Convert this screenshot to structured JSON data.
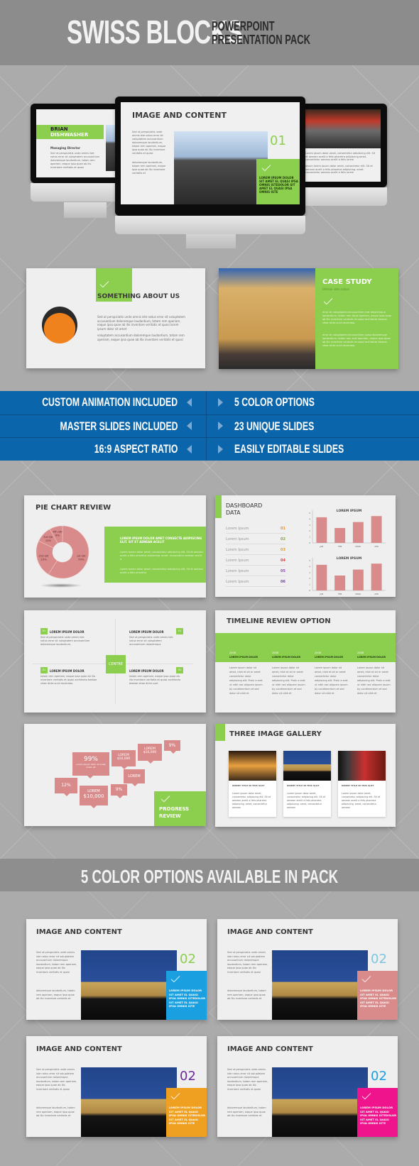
{
  "header": {
    "title": "SWISS BLOCKS",
    "subtitle_line1": "POWERPOINT",
    "subtitle_line2": "PRESENTATION PACK"
  },
  "monitors": {
    "left": {
      "name_line1": "BRIAN",
      "name_line2": "DISHWASHER",
      "role": "Managing Director",
      "body": "Sed ut perspiciatis unde omnis iste natus error sit voluptatem accusantium doloremque laudantium, totam rem aperiam, eaque ipsa quae ab illo inventore veritatis et quasi"
    },
    "center": {
      "title": "IMAGE AND CONTENT",
      "number": "01",
      "body1": "Sed ut perspiciatis unde omnis iste natus error sit voluptatem accusantium doloremque laudantium, totam rem aperiam, eaque ipsa quae ab illo inventore veritatis et quasi",
      "body2": "doloremque laudantium, totam rem aperiam, eaque ipsa quae ab illo inventore veritatis et",
      "box_text": "LOREM IPSUM DOLOR SIT AMET EL QUASI IPSA OMNIS ISTEDOLOR SIT AMET EL QUASI IPSA OMNIS ISTE"
    },
    "right": {
      "body1": "Lorem ipsum dolor amet, consectetur adipiscing elit. Sit et aenean acelit a felis pharetra adipiscing amet, consectetur aenean acelit a felis lorem",
      "body2": "Ipsum lorem ipsum dolor amet, consectetur elit. Sit et aenean acelit a felis pharetra adipiscing. amet, consectetur aenean acelit a felis lorem"
    }
  },
  "about_slide": {
    "title": "SOMETHING ABOUT US",
    "body1": "Sed ut perspiciatis unde omnis iste natus error sit voluptatem accusantium doloremque laudantium, totam rem aperiam, eaque ipsa quae ab illo inventore veritatis et quasi lorem ipsum dolor sit amet",
    "body2": "voluptatem accusantium doloremque laudantium, totam rem aperiam, eaque ipsa quae ab illo inventore veritatis et quasi"
  },
  "case_study": {
    "title": "CASE STUDY",
    "subtitle": "Omnis iste natus",
    "body1": "error sit voluptatem accusantium erat doloremque laudantium, totam rem dicta aperiam, eaque ipsa quae ab illo inventore veritatis et quasi architecto beatae vitae dicta sunt explicabo.",
    "body2": "error sit voluptatem accusantium quisa doloremque laudantium, totam rem erat aperiam, eaque ipsa quae ab illo inventore veritatis et quasi architecto beatae vitae dicta sunt explicabo."
  },
  "features": {
    "left": [
      "CUSTOM ANIMATION INCLUDED",
      "MASTER SLIDES INCLUDED",
      "16:9 ASPECT  RATIO"
    ],
    "right": [
      "5 COLOR OPTIONS",
      "23 UNIQUE SLIDES",
      "EASILY EDITABLE SLIDES"
    ],
    "band_color": "#0b65ab"
  },
  "pie_slide": {
    "title": "PIE CHART REVIEW",
    "box_heading": "LOREM IPSUM DOLOR AMET CONSECTE ADIPISCING ELIT. SIT ET AENEAN ACELIT",
    "box_body1": "Lorem ipsum dolor amet, consectetur adipiscing elit. Sit et aenean acelit a felis pharetra adipiscing. amet, consectetur aenean acelit a",
    "box_body2": "Lorem ipsum dolor amet, consectetur adipiscing elit. Sit et aenean acelit a felis pharetra"
  },
  "dashboard_slide": {
    "title_line1": "DASHBOARD",
    "title_line2": "DATA",
    "rows": [
      {
        "label": "Lorem Ipsum",
        "num": "01",
        "color": "#e8922e"
      },
      {
        "label": "Lorem Ipsum",
        "num": "02",
        "color": "#7aab3a"
      },
      {
        "label": "Lorem Ipsum",
        "num": "03",
        "color": "#e0a21f"
      },
      {
        "label": "Lorem Ipsum",
        "num": "04",
        "color": "#e23b3b"
      },
      {
        "label": "Lorem Ipsum",
        "num": "05",
        "color": "#9a43c9"
      },
      {
        "label": "Lorem Ipsum",
        "num": "06",
        "color": "#7a3fb8"
      }
    ]
  },
  "centre_slide": {
    "centre_label": "CENTRE",
    "badge": "01",
    "items": [
      {
        "heading": "LOREM IPSUM DOLOR",
        "body": "Sed ut perspiciatis unde omnis iste natus error sit voluptatem accusantium doloremque laudantium,"
      },
      {
        "heading": "LOREM IPSUM DOLOR",
        "body": "Sed ut perspiciatis unde omnis iste natus error sit voluptatem accusantium doloremque"
      },
      {
        "heading": "LOREM IPSUM DOLOR",
        "body": "totam rem aperiam, eaque ipsa quae ab illo inventore veritatis et quasi architecto beatae vitae dicta sunt explicabo."
      },
      {
        "heading": "LOREM IPSUM DOLOR",
        "body": "totam rem aperiam, eaque ipsa quae ab illo inventore veritatis et quasi architecto beatae vitae dicta sunt"
      }
    ]
  },
  "timeline_slide": {
    "title": "TIMELINE REVIEW OPTION",
    "columns": [
      {
        "year": "2008",
        "heading": "LOREM IPSUM DOLOR",
        "body": "Lorem ipsum dolor sit amet, nibh et sit er amet consectetur dolor adipiscing elit. Proin a erat ut nibh nec aliquam ipsum by condimentum et sed dolor sit nibh et"
      },
      {
        "year": "2008",
        "heading": "LOREM IPSUM DOLOR",
        "body": "Lorem ipsum dolor sit amet, nibh et sit er amet consectetur dolor adipiscing elit. Proin a erat ut nibh nec aliquam ipsum by condimentum et sed dolor sit nibh et"
      },
      {
        "year": "2008",
        "heading": "LOREM IPSUM DOLOR",
        "body": "Lorem ipsum dolor sit amet, nibh et sit er amet consectetur dolor adipiscing elit. Proin a erat ut nibh nec aliquam ipsum by condimentum et sed dolor sit nibh et"
      },
      {
        "year": "2008",
        "heading": "LOREM IPSUM DOLOR",
        "body": "Lorem ipsum dolor sit amet, nibh et sit er amet consectetur dolor adipiscing elit. Proin a erat ut nibh nec aliquam ipsum by condimentum et sed dolor sit nibh et"
      }
    ]
  },
  "progress_slide": {
    "box_line1": "PROGRESS",
    "box_line2": "REVIEW",
    "callouts": [
      {
        "text": "99%",
        "sub": "Lorem ipsum dolor sit amet lorem sit"
      },
      {
        "text": "LOREM",
        "sub": "$10,000"
      },
      {
        "text": "LOREM",
        "sub": "$10,000"
      },
      {
        "text": "9%",
        "sub": ""
      },
      {
        "text": "LOREM",
        "sub": ""
      },
      {
        "text": "12%",
        "sub": ""
      },
      {
        "text": "LOREM",
        "sub": "$10,000"
      },
      {
        "text": "9%",
        "sub": ""
      }
    ]
  },
  "gallery_slide": {
    "title": "THREE IMAGE GALLERY",
    "cards": [
      {
        "title": "INSERT TITLE IN THIS SLOT",
        "body": "Lorem ipsum dolor amet, consectetur adipiscing elit. Sit et aenean acelit a felis pharetra adipiscing. amet, consectetur aenean"
      },
      {
        "title": "INSERT TITLE IN THIS SLOT",
        "body": "Lorem ipsum dolor amet, consectetur adipiscing elit. Sit et aenean acelit a felis pharetra adipiscing. amet, consectetur aenean"
      },
      {
        "title": "INSERT TITLE IN THIS SLOT",
        "body": "Lorem ipsum dolor amet, consectetur adipiscing elit. Sit et aenean acelit a felis pharetra adipiscing. amet, consectetur aenean"
      }
    ]
  },
  "colors_banner": {
    "text": "5 COLOR OPTIONS AVAILABLE IN PACK"
  },
  "color_variants": [
    {
      "title": "IMAGE AND CONTENT",
      "number": "02",
      "number_color": "#8cce4e",
      "box_color": "#1aa0e0"
    },
    {
      "title": "IMAGE AND CONTENT",
      "number": "02",
      "number_color": "#7cc6e2",
      "box_color": "#d98a8a"
    },
    {
      "title": "IMAGE AND CONTENT",
      "number": "02",
      "number_color": "#6a2b9c",
      "box_color": "#f0a020"
    },
    {
      "title": "IMAGE AND CONTENT",
      "number": "02",
      "number_color": "#1aa0e0",
      "box_color": "#f0148c"
    }
  ],
  "variant_text": {
    "body1": "Sed ut perspiciatis unde omnis iste natus error sit voluptatem accusantium doloremque laudantium, totam rem aperiam, eaque ipsa quae ab illo inventore veritatis et quasi",
    "body2": "doloremque laudantium, totam rem aperiam, eaque ipsa quae ab illo inventore veritatis et",
    "box_text": "LOREM IPSUM DOLOR SIT AMET EL QUASI IPSA OMNIS ISTEDOLOR SIT AMET EL QUASI IPSA OMNIS ISTE"
  },
  "colors": {
    "green": "#8cce4e",
    "blue_band": "#0b65ab",
    "pink_chart": "#d98a8a",
    "banner_gray": "#8c8c8c"
  },
  "chart_data": [
    {
      "type": "pie",
      "title": "PIE CHART REVIEW",
      "donut": true,
      "categories": [
        "1st Qtr",
        "2nd Qtr",
        "3rd Qtr",
        "4th Qtr"
      ],
      "values": [
        59,
        23,
        10,
        8
      ],
      "labels": [
        "1st Qtr 59%",
        "2nd Qtr 23%",
        "3rd Qtr 10%",
        "4th Qtr 8%"
      ]
    },
    {
      "type": "bar",
      "title": "LOREM IPSUM",
      "categories": [
        "JAN",
        "FEB",
        "MARC",
        "APR"
      ],
      "values": [
        4.3,
        2.5,
        3.5,
        4.5
      ],
      "yticks": [
        0,
        1,
        2,
        3,
        4,
        5
      ],
      "ylim": [
        0,
        5
      ]
    },
    {
      "type": "bar",
      "title": "LOREM IPSUM",
      "categories": [
        "JAN",
        "FEB",
        "MARC",
        "APR"
      ],
      "values": [
        4.3,
        2.5,
        3.5,
        4.5
      ],
      "yticks": [
        0,
        1,
        2,
        3,
        4,
        5
      ],
      "ylim": [
        0,
        5
      ]
    }
  ]
}
